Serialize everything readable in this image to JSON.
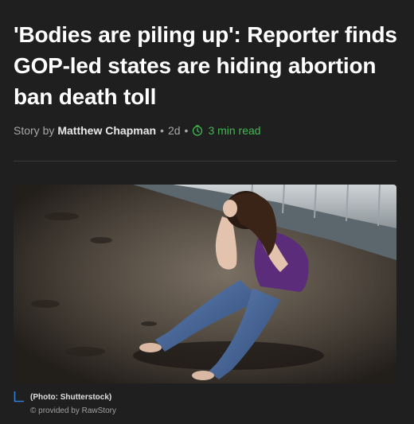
{
  "article": {
    "headline": "'Bodies are piling up': Reporter finds GOP-led states are hiding abortion ban death toll",
    "byline_prefix": "Story by",
    "author": "Matthew Chapman",
    "age": "2d",
    "read_time": "3 min read"
  },
  "image": {
    "caption": "(Photo: Shutterstock)",
    "provider": "© provided by RawStory"
  },
  "colors": {
    "background": "#1f1f1f",
    "read_time_accent": "#3fb950",
    "caption_marker": "#2f7fd6"
  },
  "icons": {
    "read_time": "clock-icon",
    "caption_marker": "corner-bracket-icon"
  }
}
